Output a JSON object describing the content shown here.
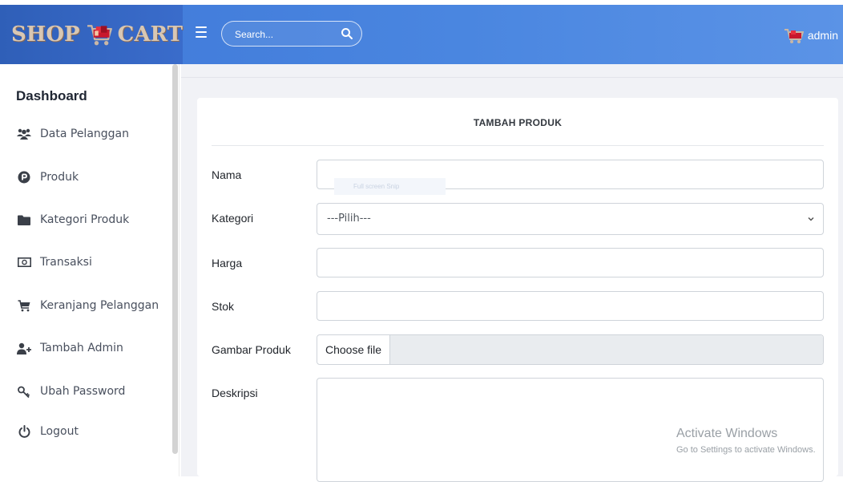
{
  "brand": {
    "left": "SHOP",
    "right": "CART"
  },
  "search": {
    "placeholder": "Search..."
  },
  "user": {
    "name": "admin"
  },
  "sidebar": {
    "title": "Dashboard",
    "items": [
      {
        "label": "Data Pelanggan",
        "icon": "users-icon"
      },
      {
        "label": "Produk",
        "icon": "product-p-icon"
      },
      {
        "label": "Kategori Produk",
        "icon": "folder-icon"
      },
      {
        "label": "Transaksi",
        "icon": "money-icon"
      },
      {
        "label": "Keranjang Pelanggan",
        "icon": "cart-icon"
      },
      {
        "label": "Tambah Admin",
        "icon": "user-plus-icon"
      },
      {
        "label": "Ubah Password",
        "icon": "key-icon"
      },
      {
        "label": "Logout",
        "icon": "power-icon"
      }
    ]
  },
  "form": {
    "title": "TAMBAH PRODUK",
    "fields": {
      "nama": {
        "label": "Nama",
        "value": ""
      },
      "kategori": {
        "label": "Kategori",
        "selected": "---Pilih---"
      },
      "harga": {
        "label": "Harga",
        "value": ""
      },
      "stok": {
        "label": "Stok",
        "value": ""
      },
      "gambar": {
        "label": "Gambar Produk",
        "button": "Choose file"
      },
      "deskripsi": {
        "label": "Deskripsi",
        "value": ""
      }
    }
  },
  "overlay": {
    "fullscreen_hint": "Full screen Snip"
  },
  "watermark": {
    "title": "Activate Windows",
    "subtitle": "Go to Settings to activate Windows."
  },
  "colors": {
    "navbar": "#4a86e0",
    "brand_text": "#d8c7b3",
    "content_bg": "#f1f2f6"
  }
}
